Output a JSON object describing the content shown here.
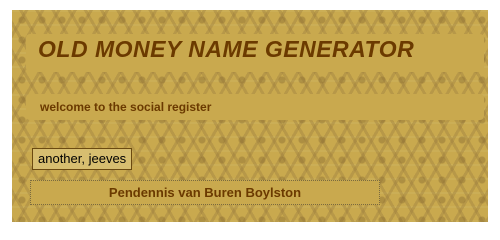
{
  "header": {
    "title": "OLD MONEY NAME GENERATOR",
    "subtitle": "welcome to the social register"
  },
  "controls": {
    "generate_label": "another, jeeves"
  },
  "output": {
    "generated_name": "Pendennis van Buren Boylston"
  },
  "colors": {
    "background": "#c9a94e",
    "text_brown": "#6b3a00"
  }
}
